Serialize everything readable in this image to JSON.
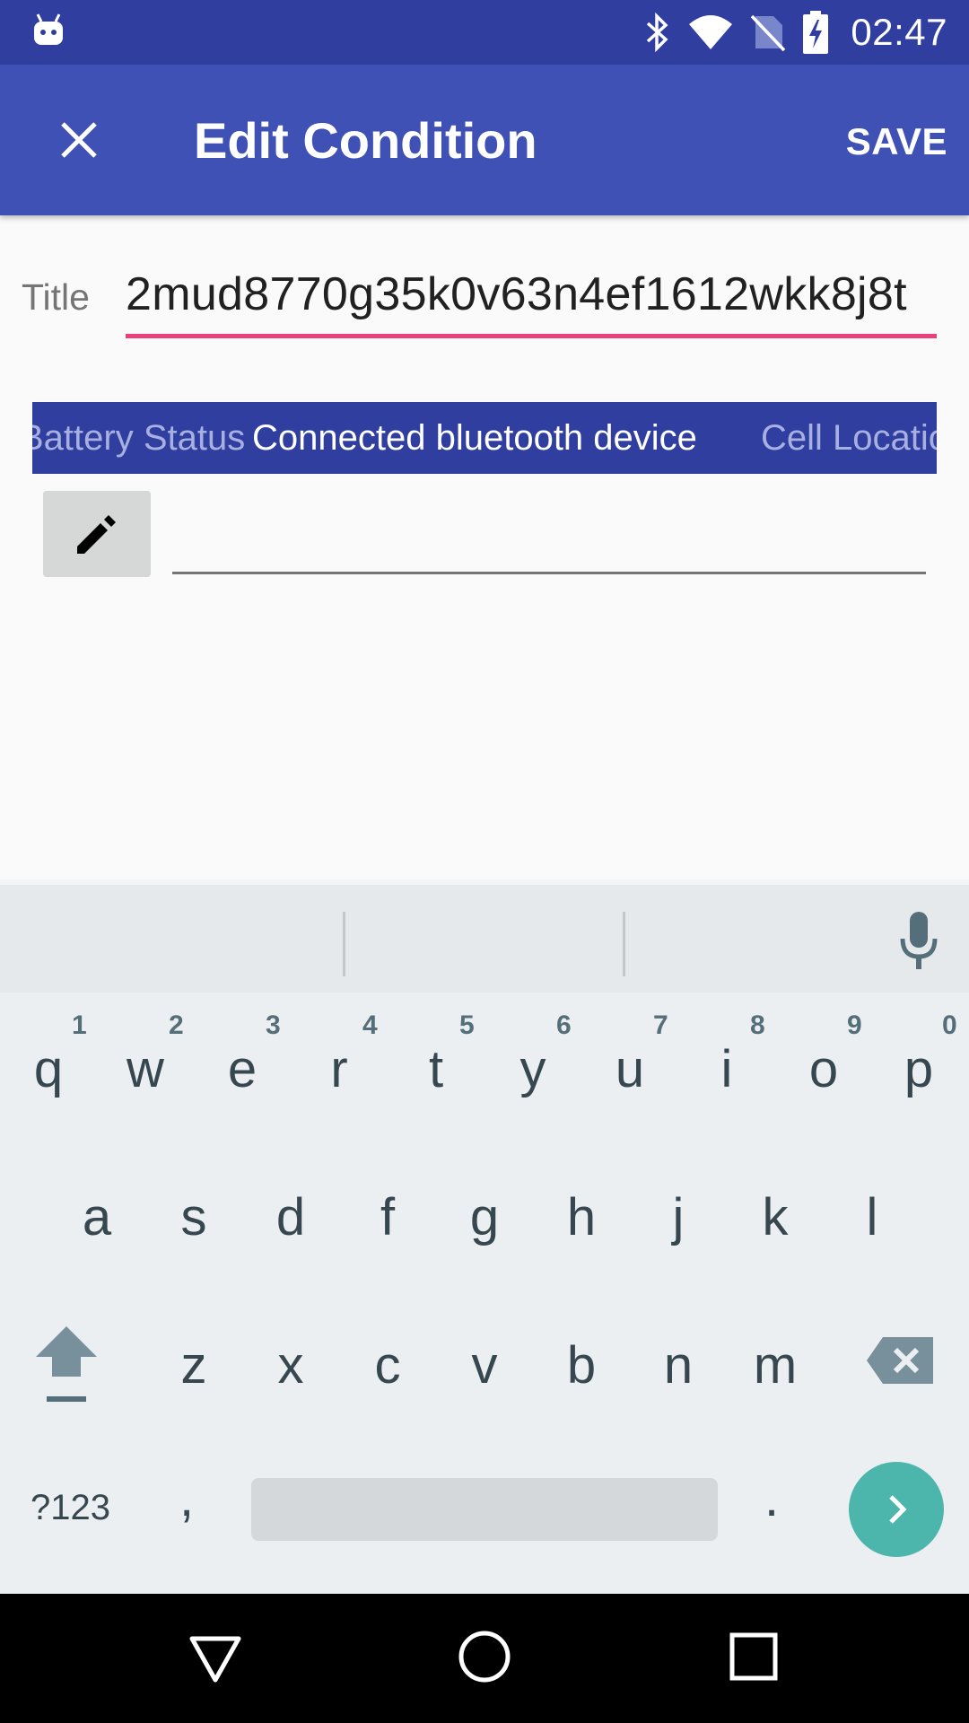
{
  "status_bar": {
    "time": "02:47",
    "icons": [
      "android-robot-icon",
      "bluetooth-icon",
      "wifi-icon",
      "no-sim-icon",
      "battery-charging-icon"
    ]
  },
  "app_bar": {
    "close_icon": "close-icon",
    "title": "Edit Condition",
    "save_label": "SAVE",
    "color": "#3f51b5"
  },
  "form": {
    "title_label": "Title",
    "title_value": "2mud8770g35k0v63n4ef1612wkk8j8t",
    "accent": "#ec407a"
  },
  "tabs": [
    {
      "label": "Battery Status",
      "selected": false
    },
    {
      "label": "Connected bluetooth device",
      "selected": true
    },
    {
      "label": "Cell Location",
      "selected": false
    }
  ],
  "edit_row": {
    "icon": "pencil-icon",
    "value": ""
  },
  "keyboard": {
    "row1": [
      "q",
      "w",
      "e",
      "r",
      "t",
      "y",
      "u",
      "i",
      "o",
      "p"
    ],
    "row1_hints": [
      "1",
      "2",
      "3",
      "4",
      "5",
      "6",
      "7",
      "8",
      "9",
      "0"
    ],
    "row2": [
      "a",
      "s",
      "d",
      "f",
      "g",
      "h",
      "j",
      "k",
      "l"
    ],
    "row3": [
      "z",
      "x",
      "c",
      "v",
      "b",
      "n",
      "m"
    ],
    "symbols_label": "?123",
    "comma": ",",
    "period": ".",
    "enter_color": "#4db6ac"
  },
  "nav_bar": {
    "icons": [
      "back-icon",
      "home-icon",
      "recents-icon"
    ]
  }
}
